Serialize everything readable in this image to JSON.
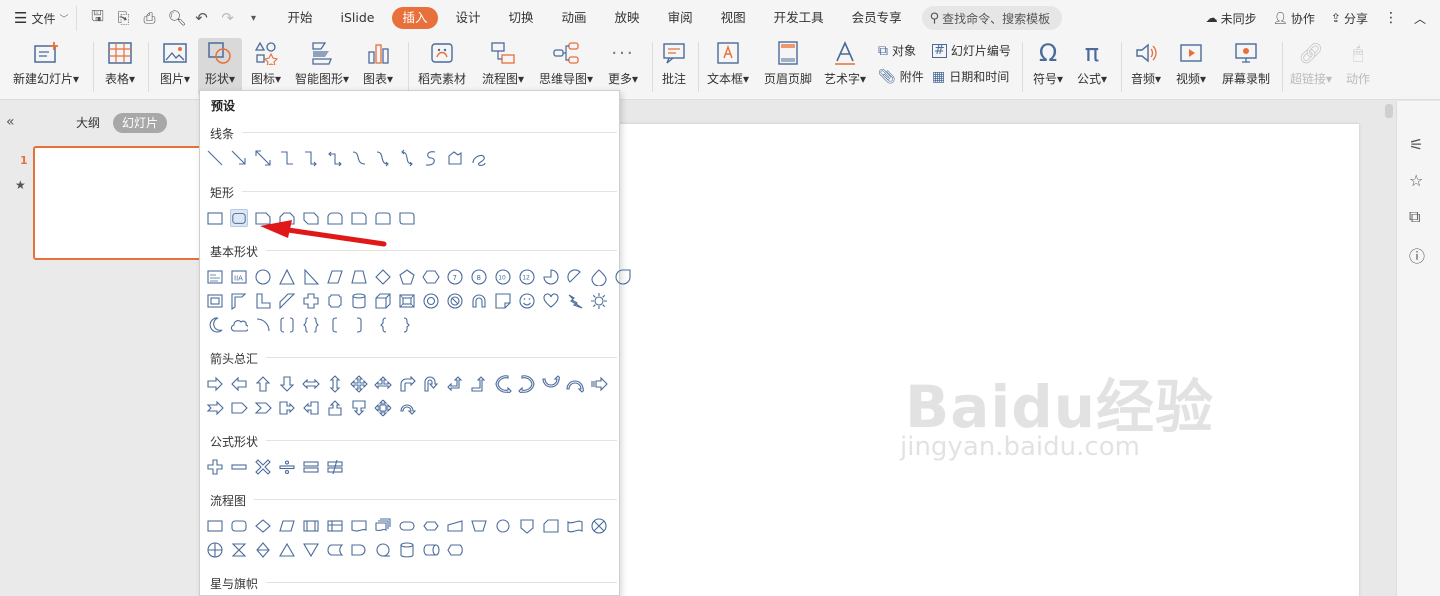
{
  "menubar": {
    "file_label": "文件",
    "tabs": [
      "开始",
      "iSlide",
      "插入",
      "设计",
      "切换",
      "动画",
      "放映",
      "审阅",
      "视图",
      "开发工具",
      "会员专享"
    ],
    "active_tab": "插入",
    "search_placeholder": "查找命令、搜索模板",
    "sync_label": "未同步",
    "collab_label": "协作",
    "share_label": "分享"
  },
  "ribbon": {
    "new_slide": "新建幻灯片",
    "table": "表格",
    "picture": "图片",
    "shape": "形状",
    "icon": "图标",
    "smartart": "智能图形",
    "chart": "图表",
    "material": "稻壳素材",
    "flowchart": "流程图",
    "mindmap": "思维导图",
    "more": "更多",
    "comment": "批注",
    "textbox": "文本框",
    "header_footer": "页眉页脚",
    "wordart": "艺术字",
    "object": "对象",
    "attachment": "附件",
    "slide_number": "幻灯片编号",
    "datetime": "日期和时间",
    "symbol": "符号",
    "formula": "公式",
    "audio": "音频",
    "video": "视频",
    "screen_record": "屏幕录制",
    "hyperlink": "超链接",
    "action": "动作"
  },
  "left_panel": {
    "outline_label": "大纲",
    "slides_label": "幻灯片",
    "slide_number": "1"
  },
  "dropdown": {
    "title": "预设",
    "sections": {
      "lines": "线条",
      "rectangles": "矩形",
      "basic": "基本形状",
      "arrows": "箭头总汇",
      "equation": "公式形状",
      "flowchart": "流程图",
      "stars": "星与旗帜"
    }
  },
  "watermark": {
    "brand": "Baidu经验",
    "url": "jingyan.baidu.com"
  },
  "colors": {
    "accent": "#e8703a",
    "shape_stroke": "#4a6b9a",
    "highlight": "#dde6f3",
    "arrow": "#e01818"
  }
}
